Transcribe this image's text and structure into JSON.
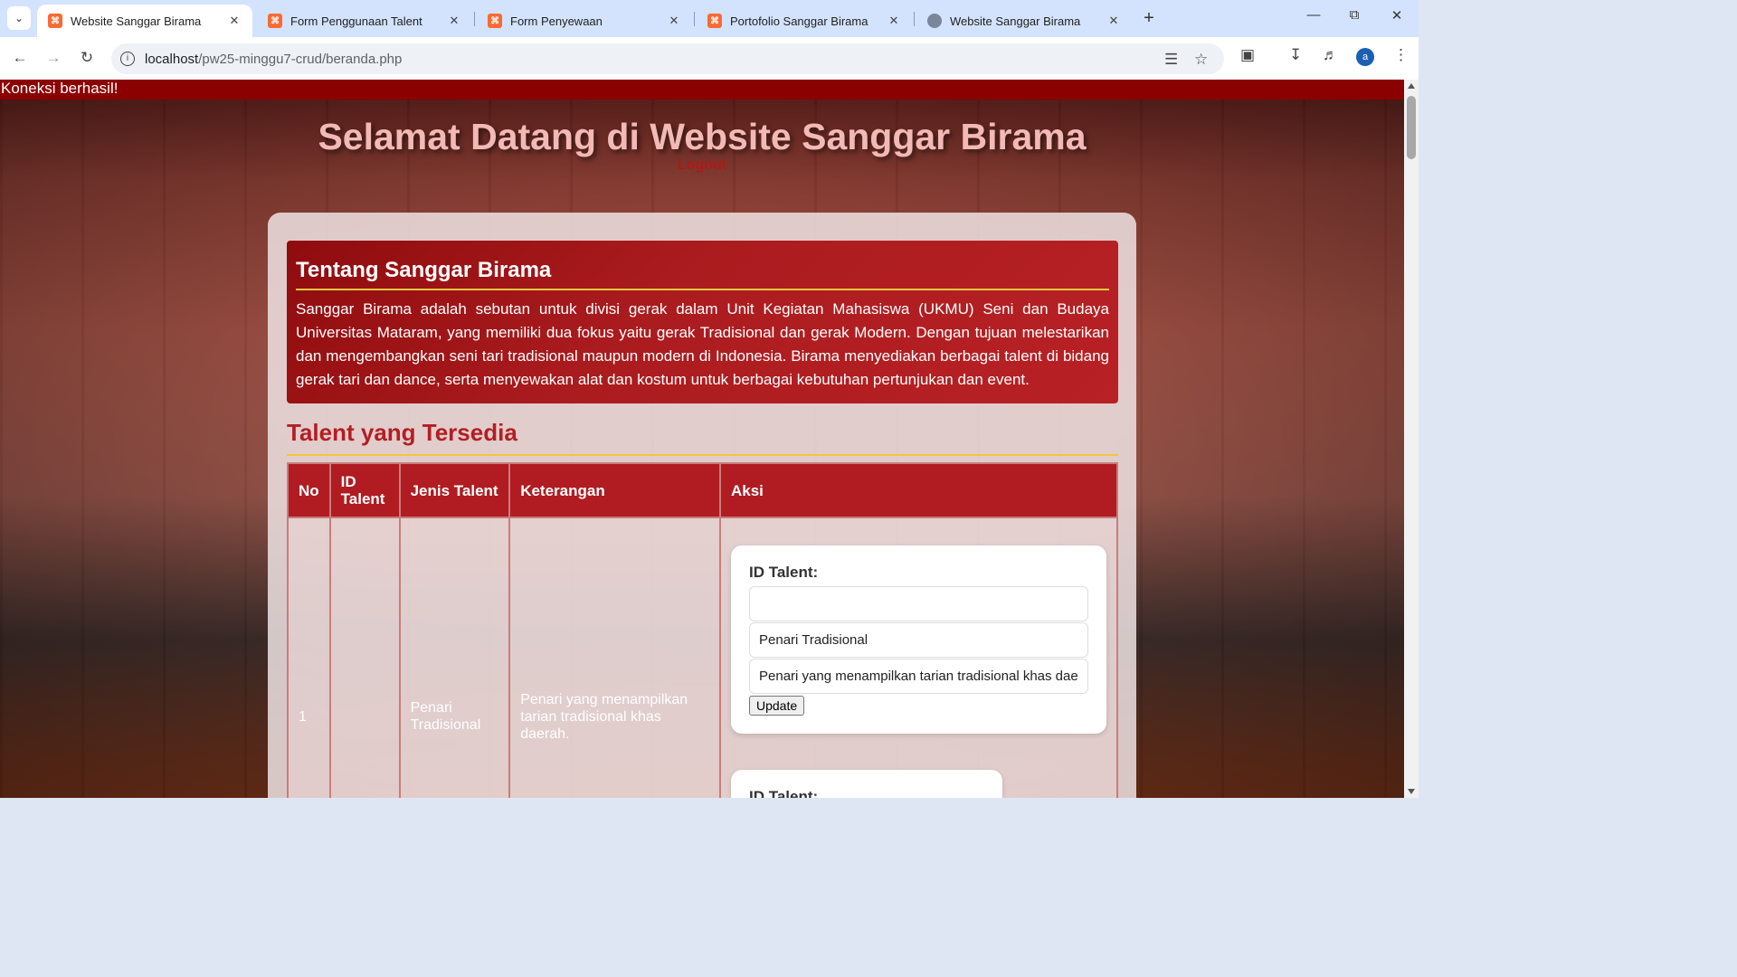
{
  "browser": {
    "tabs": [
      {
        "title": "Website Sanggar Birama",
        "favicon": "xampp-icon",
        "active": true
      },
      {
        "title": "Form Penggunaan Talent",
        "favicon": "xampp-icon",
        "active": false
      },
      {
        "title": "Form Penyewaan",
        "favicon": "xampp-icon",
        "active": false
      },
      {
        "title": "Portofolio Sanggar Birama",
        "favicon": "xampp-icon",
        "active": false
      },
      {
        "title": "Website Sanggar Birama",
        "favicon": "globe-icon",
        "active": false
      }
    ],
    "url_host": "localhost",
    "url_path": "/pw25-minggu7-crud/beranda.php",
    "avatar_letter": "a"
  },
  "page": {
    "connection_status": "Koneksi berhasil!",
    "hero_title": "Selamat Datang di Website Sanggar Birama",
    "logout_label": "Logout",
    "about": {
      "heading": "Tentang Sanggar Birama",
      "text": "Sanggar Birama adalah sebutan untuk divisi gerak dalam Unit Kegiatan Mahasiswa (UKMU) Seni dan Budaya Universitas Mataram, yang memiliki dua fokus yaitu gerak Tradisional dan gerak Modern. Dengan tujuan melestarikan dan mengembangkan seni tari tradisional maupun modern di Indonesia. Birama menyediakan berbagai talent di bidang gerak tari dan dance, serta menyewakan alat dan kostum untuk berbagai kebutuhan pertunjukan dan event."
    },
    "talent_section": {
      "title": "Talent yang Tersedia",
      "headers": {
        "no": "No",
        "id": "ID Talent",
        "jenis": "Jenis Talent",
        "keterangan": "Keterangan",
        "aksi": "Aksi"
      },
      "rows": [
        {
          "no": "1",
          "id": "",
          "jenis": "Penari Tradisional",
          "keterangan": "Penari yang menampilkan tarian tradisional khas daerah.",
          "form": {
            "id_label": "ID Talent:",
            "id_value": "",
            "jenis_value": "Penari Tradisional",
            "keterangan_value": "Penari yang menampilkan tarian tradisional khas daerah.",
            "update_label": "Update"
          }
        }
      ],
      "second_form_label": "ID Talent:"
    }
  },
  "colors": {
    "header_red": "#8b0000",
    "title_pink": "#f2b9b5",
    "table_header": "#b01c22",
    "accent_gold": "#f0c640"
  }
}
